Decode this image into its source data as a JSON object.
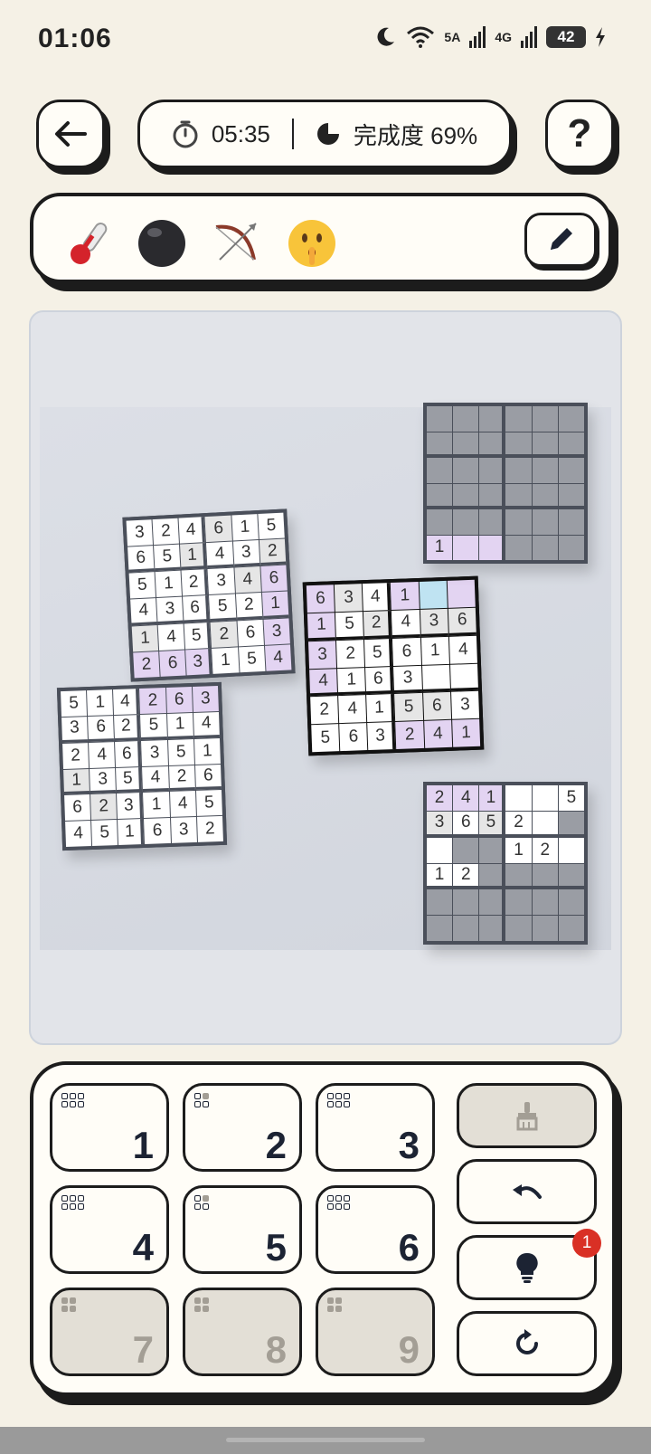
{
  "status_bar": {
    "time": "01:06",
    "network_5g": "5A",
    "network_4g": "4G",
    "battery": "42"
  },
  "header": {
    "timer": "05:35",
    "progress_label": "完成度 69%",
    "help": "?"
  },
  "tools": {
    "items": [
      {
        "name": "thermometer-icon"
      },
      {
        "name": "black-ball-icon"
      },
      {
        "name": "bow-arrow-icon"
      },
      {
        "name": "shushing-face-icon"
      }
    ]
  },
  "board": {
    "grids": [
      {
        "name": "grid-top-left",
        "rows": [
          [
            [
              "3",
              ""
            ],
            [
              "2",
              ""
            ],
            [
              "4",
              ""
            ],
            [
              "6",
              "g"
            ],
            [
              "1",
              ""
            ],
            [
              "5",
              ""
            ]
          ],
          [
            [
              "6",
              ""
            ],
            [
              "5",
              ""
            ],
            [
              "1",
              "g"
            ],
            [
              "4",
              ""
            ],
            [
              "3",
              ""
            ],
            [
              "2",
              "g"
            ]
          ],
          [
            [
              "5",
              ""
            ],
            [
              "1",
              ""
            ],
            [
              "2",
              ""
            ],
            [
              "3",
              ""
            ],
            [
              "4",
              "g"
            ],
            [
              "6",
              "p"
            ]
          ],
          [
            [
              "4",
              ""
            ],
            [
              "3",
              ""
            ],
            [
              "6",
              ""
            ],
            [
              "5",
              ""
            ],
            [
              "2",
              ""
            ],
            [
              "1",
              "p"
            ]
          ],
          [
            [
              "1",
              "g"
            ],
            [
              "4",
              ""
            ],
            [
              "5",
              ""
            ],
            [
              "2",
              "g"
            ],
            [
              "6",
              ""
            ],
            [
              "3",
              "p"
            ]
          ],
          [
            [
              "2",
              "p"
            ],
            [
              "6",
              "p"
            ],
            [
              "3",
              "p"
            ],
            [
              "1",
              ""
            ],
            [
              "5",
              ""
            ],
            [
              "4",
              "p"
            ]
          ]
        ]
      },
      {
        "name": "grid-bottom-left",
        "rows": [
          [
            [
              "5",
              ""
            ],
            [
              "1",
              ""
            ],
            [
              "4",
              ""
            ],
            [
              "2",
              "p"
            ],
            [
              "6",
              "p"
            ],
            [
              "3",
              "p"
            ]
          ],
          [
            [
              "3",
              ""
            ],
            [
              "6",
              ""
            ],
            [
              "2",
              ""
            ],
            [
              "5",
              ""
            ],
            [
              "1",
              ""
            ],
            [
              "4",
              ""
            ]
          ],
          [
            [
              "2",
              ""
            ],
            [
              "4",
              ""
            ],
            [
              "6",
              ""
            ],
            [
              "3",
              ""
            ],
            [
              "5",
              ""
            ],
            [
              "1",
              ""
            ]
          ],
          [
            [
              "1",
              "g"
            ],
            [
              "3",
              ""
            ],
            [
              "5",
              ""
            ],
            [
              "4",
              ""
            ],
            [
              "2",
              ""
            ],
            [
              "6",
              ""
            ]
          ],
          [
            [
              "6",
              ""
            ],
            [
              "2",
              "g"
            ],
            [
              "3",
              ""
            ],
            [
              "1",
              ""
            ],
            [
              "4",
              ""
            ],
            [
              "5",
              ""
            ]
          ],
          [
            [
              "4",
              ""
            ],
            [
              "5",
              ""
            ],
            [
              "1",
              ""
            ],
            [
              "6",
              ""
            ],
            [
              "3",
              ""
            ],
            [
              "2",
              ""
            ]
          ]
        ]
      },
      {
        "name": "grid-center-main",
        "rows": [
          [
            [
              "6",
              "p"
            ],
            [
              "3",
              "g"
            ],
            [
              "4",
              ""
            ],
            [
              "1",
              "p"
            ],
            [
              "",
              "b"
            ],
            [
              "",
              "p"
            ]
          ],
          [
            [
              "1",
              "p"
            ],
            [
              "5",
              ""
            ],
            [
              "2",
              "g"
            ],
            [
              "4",
              ""
            ],
            [
              "3",
              "g"
            ],
            [
              "6",
              "g"
            ]
          ],
          [
            [
              "3",
              "p"
            ],
            [
              "2",
              ""
            ],
            [
              "5",
              ""
            ],
            [
              "6",
              ""
            ],
            [
              "1",
              ""
            ],
            [
              "4",
              ""
            ]
          ],
          [
            [
              "4",
              "p"
            ],
            [
              "1",
              ""
            ],
            [
              "6",
              ""
            ],
            [
              "3",
              ""
            ],
            [
              "",
              ""
            ],
            [
              "",
              ""
            ]
          ],
          [
            [
              "2",
              ""
            ],
            [
              "4",
              ""
            ],
            [
              "1",
              ""
            ],
            [
              "5",
              "g"
            ],
            [
              "6",
              "g"
            ],
            [
              "3",
              ""
            ]
          ],
          [
            [
              "5",
              ""
            ],
            [
              "6",
              ""
            ],
            [
              "3",
              ""
            ],
            [
              "2",
              "p"
            ],
            [
              "4",
              "p"
            ],
            [
              "1",
              "p"
            ]
          ]
        ]
      },
      {
        "name": "grid-top-right",
        "rows": [
          [
            [
              "",
              "d"
            ],
            [
              "",
              "d"
            ],
            [
              "",
              "d"
            ],
            [
              "",
              "d"
            ],
            [
              "",
              "d"
            ],
            [
              "",
              "d"
            ]
          ],
          [
            [
              "",
              "d"
            ],
            [
              "",
              "d"
            ],
            [
              "",
              "d"
            ],
            [
              "",
              "d"
            ],
            [
              "",
              "d"
            ],
            [
              "",
              "d"
            ]
          ],
          [
            [
              "",
              "d"
            ],
            [
              "",
              "d"
            ],
            [
              "",
              "d"
            ],
            [
              "",
              "d"
            ],
            [
              "",
              "d"
            ],
            [
              "",
              "d"
            ]
          ],
          [
            [
              "",
              "d"
            ],
            [
              "",
              "d"
            ],
            [
              "",
              "d"
            ],
            [
              "",
              "d"
            ],
            [
              "",
              "d"
            ],
            [
              "",
              "d"
            ]
          ],
          [
            [
              "",
              "d"
            ],
            [
              "",
              "d"
            ],
            [
              "",
              "d"
            ],
            [
              "",
              "d"
            ],
            [
              "",
              "d"
            ],
            [
              "",
              "d"
            ]
          ],
          [
            [
              "1",
              "p"
            ],
            [
              "",
              "p"
            ],
            [
              "",
              "p"
            ],
            [
              "",
              "d"
            ],
            [
              "",
              "d"
            ],
            [
              "",
              "d"
            ]
          ]
        ]
      },
      {
        "name": "grid-bottom-right",
        "rows": [
          [
            [
              "2",
              "p"
            ],
            [
              "4",
              "p"
            ],
            [
              "1",
              "p"
            ],
            [
              "",
              ""
            ],
            [
              "",
              ""
            ],
            [
              "5",
              ""
            ]
          ],
          [
            [
              "3",
              "g"
            ],
            [
              "6",
              ""
            ],
            [
              "5",
              "g"
            ],
            [
              "2",
              ""
            ],
            [
              "",
              ""
            ],
            [
              "",
              "d"
            ]
          ],
          [
            [
              "",
              ""
            ],
            [
              "",
              "d"
            ],
            [
              "",
              "d"
            ],
            [
              "1",
              ""
            ],
            [
              "2",
              ""
            ],
            [
              "",
              ""
            ]
          ],
          [
            [
              "1",
              ""
            ],
            [
              "2",
              ""
            ],
            [
              "",
              "d"
            ],
            [
              "",
              "d"
            ],
            [
              "",
              "d"
            ],
            [
              "",
              "d"
            ]
          ],
          [
            [
              "",
              "d"
            ],
            [
              "",
              "d"
            ],
            [
              "",
              "d"
            ],
            [
              "",
              "d"
            ],
            [
              "",
              "d"
            ],
            [
              "",
              "d"
            ]
          ],
          [
            [
              "",
              "d"
            ],
            [
              "",
              "d"
            ],
            [
              "",
              "d"
            ],
            [
              "",
              "d"
            ],
            [
              "",
              "d"
            ],
            [
              "",
              "d"
            ]
          ]
        ]
      }
    ]
  },
  "keypad": {
    "keys": [
      {
        "label": "1",
        "enabled": true
      },
      {
        "label": "2",
        "enabled": true
      },
      {
        "label": "3",
        "enabled": true
      },
      {
        "label": "4",
        "enabled": true
      },
      {
        "label": "5",
        "enabled": true
      },
      {
        "label": "6",
        "enabled": true
      },
      {
        "label": "7",
        "enabled": false
      },
      {
        "label": "8",
        "enabled": false
      },
      {
        "label": "9",
        "enabled": false
      }
    ],
    "actions": [
      {
        "name": "erase-button",
        "icon": "brush-icon",
        "enabled": false
      },
      {
        "name": "undo-button",
        "icon": "undo-icon",
        "enabled": true
      },
      {
        "name": "hint-button",
        "icon": "lightbulb-icon",
        "enabled": true,
        "badge": "1"
      },
      {
        "name": "restart-button",
        "icon": "refresh-icon",
        "enabled": true
      }
    ]
  },
  "colors": {
    "background": "#f5f1e6",
    "purple_highlight": "#e3d4f2",
    "blue_highlight": "#bfe3f2",
    "badge": "#d93025"
  }
}
